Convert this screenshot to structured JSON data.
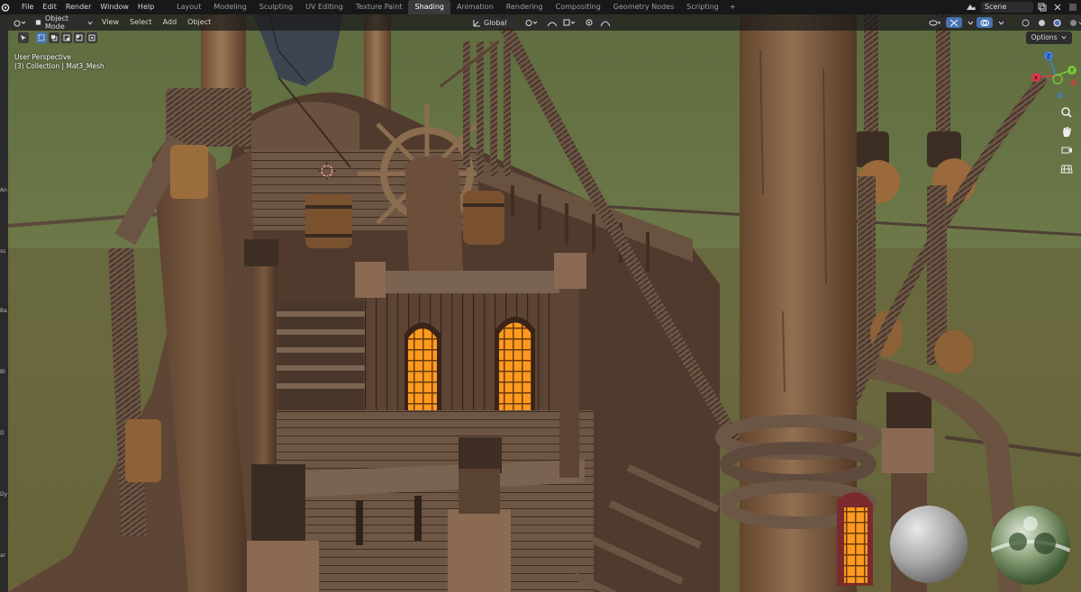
{
  "topbar": {
    "menus": [
      "File",
      "Edit",
      "Render",
      "Window",
      "Help"
    ],
    "workspaces": [
      "Layout",
      "Modeling",
      "Sculpting",
      "UV Editing",
      "Texture Paint",
      "Shading",
      "Animation",
      "Rendering",
      "Compositing",
      "Geometry Nodes",
      "Scripting"
    ],
    "active_workspace": "Shading",
    "add_workspace": "+",
    "scene_name": "Scene"
  },
  "viewport_header": {
    "mode": "Object Mode",
    "menus": [
      "View",
      "Select",
      "Add",
      "Object"
    ],
    "orientation": "Global"
  },
  "viewport": {
    "perspective": "User Perspective",
    "collection_line": "(3) Collection | Mat3_Mesh",
    "options_label": "Options"
  },
  "left_strip": [
    "An",
    "ss",
    "Ba",
    "Bl",
    "D",
    "Dy",
    "ar"
  ],
  "gizmo_axes": {
    "x": "X",
    "y": "Y",
    "z": "Z"
  },
  "colors": {
    "accent": "#4772b3",
    "axis_x": "#e0394f",
    "axis_y": "#7bc639",
    "axis_z": "#3c7fe1",
    "window_glow": "#ff9a1e"
  },
  "icons": [
    "blender-logo",
    "cursor-icon",
    "select-box-icon",
    "transform-pivot-icon",
    "snap-icon",
    "proportional-icon",
    "zoom-icon",
    "pan-hand-icon",
    "camera-icon",
    "grid-icon"
  ]
}
